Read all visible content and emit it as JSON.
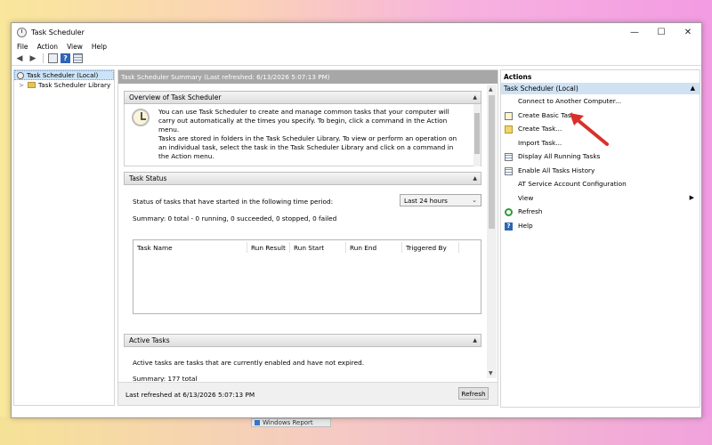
{
  "window": {
    "title": "Task Scheduler",
    "controls": {
      "minimize": "—",
      "maximize": "☐",
      "close": "✕"
    }
  },
  "menu": [
    "File",
    "Action",
    "View",
    "Help"
  ],
  "tree": {
    "root": "Task Scheduler (Local)",
    "library": "Task Scheduler Library"
  },
  "center": {
    "summary_header": "Task Scheduler Summary (Last refreshed: 6/13/2026 5:07:13 PM)",
    "overview": {
      "title": "Overview of Task Scheduler",
      "para1": "You can use Task Scheduler to create and manage common tasks that your computer will carry out automatically at the times you specify. To begin, click a command in the Action menu.",
      "para2": "Tasks are stored in folders in the Task Scheduler Library. To view or perform an operation on an individual task, select the task in the Task Scheduler Library and click on a command in the Action menu."
    },
    "task_status": {
      "title": "Task Status",
      "period_label": "Status of tasks that have started in the following time period:",
      "period_value": "Last 24 hours",
      "summary": "Summary: 0 total - 0 running, 0 succeeded, 0 stopped, 0 failed",
      "columns": [
        "Task Name",
        "Run Result",
        "Run Start",
        "Run End",
        "Triggered By"
      ]
    },
    "active_tasks": {
      "title": "Active Tasks",
      "description": "Active tasks are tasks that are currently enabled and have not expired.",
      "summary": "Summary: 177 total"
    },
    "footer": {
      "last_refreshed": "Last refreshed at 6/13/2026 5:07:13 PM",
      "refresh_label": "Refresh"
    }
  },
  "actions": {
    "title": "Actions",
    "group": "Task Scheduler (Local)",
    "items": [
      "Connect to Another Computer...",
      "Create Basic Task...",
      "Create Task...",
      "Import Task...",
      "Display All Running Tasks",
      "Enable All Tasks History",
      "AT Service Account Configuration",
      "View",
      "Refresh",
      "Help"
    ]
  },
  "taskbar": {
    "peek_label": "Windows Report"
  },
  "colors": {
    "annotation_arrow": "#d9302b",
    "selection": "#cce4f7",
    "summary_header_bg": "#a7a7a7"
  }
}
